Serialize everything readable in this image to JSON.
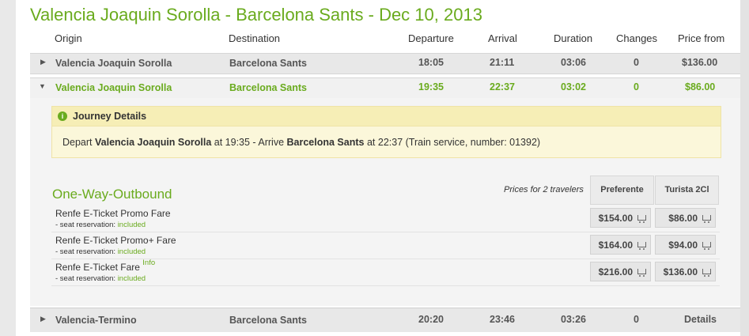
{
  "title": "Valencia Joaquin Sorolla - Barcelona Sants - Dec 10, 2013",
  "headers": {
    "origin": "Origin",
    "destination": "Destination",
    "departure": "Departure",
    "arrival": "Arrival",
    "duration": "Duration",
    "changes": "Changes",
    "price_from": "Price from"
  },
  "journeys": [
    {
      "origin": "Valencia Joaquin Sorolla",
      "destination": "Barcelona Sants",
      "departure": "18:05",
      "arrival": "21:11",
      "duration": "03:06",
      "changes": "0",
      "price": "$136.00"
    },
    {
      "origin": "Valencia Joaquin Sorolla",
      "destination": "Barcelona Sants",
      "departure": "19:35",
      "arrival": "22:37",
      "duration": "03:02",
      "changes": "0",
      "price": "$86.00"
    },
    {
      "origin": "Valencia-Termino",
      "destination": "Barcelona Sants",
      "departure": "20:20",
      "arrival": "23:46",
      "duration": "03:26",
      "changes": "0",
      "price": "Details"
    }
  ],
  "journey_details": {
    "title": "Journey Details",
    "depart_prefix": "Depart",
    "depart_station": "Valencia Joaquin Sorolla",
    "depart_time": "at 19:35 - Arrive",
    "arrive_station": "Barcelona Sants",
    "arrive_suffix": "at 22:37 (Train service, number: 01392)"
  },
  "fares_section": {
    "title": "One-Way-Outbound",
    "prices_for": "Prices for 2 travelers",
    "classes": [
      "Preferente",
      "Turista 2Cl"
    ],
    "seat_label": "- seat reservation:",
    "included_label": "included",
    "info_label": "Info",
    "fares": [
      {
        "name": "Renfe E-Ticket Promo Fare",
        "prices": [
          "$154.00",
          "$86.00"
        ]
      },
      {
        "name": "Renfe E-Ticket Promo+ Fare",
        "prices": [
          "$164.00",
          "$94.00"
        ]
      },
      {
        "name": "Renfe E-Ticket Fare",
        "prices": [
          "$216.00",
          "$136.00"
        ]
      }
    ]
  },
  "colors": {
    "accent": "#6aab1e",
    "details_bg": "#fbf7da"
  },
  "icons": [
    "collapse-arrow-icon",
    "expand-arrow-icon",
    "info-icon",
    "cart-icon"
  ]
}
